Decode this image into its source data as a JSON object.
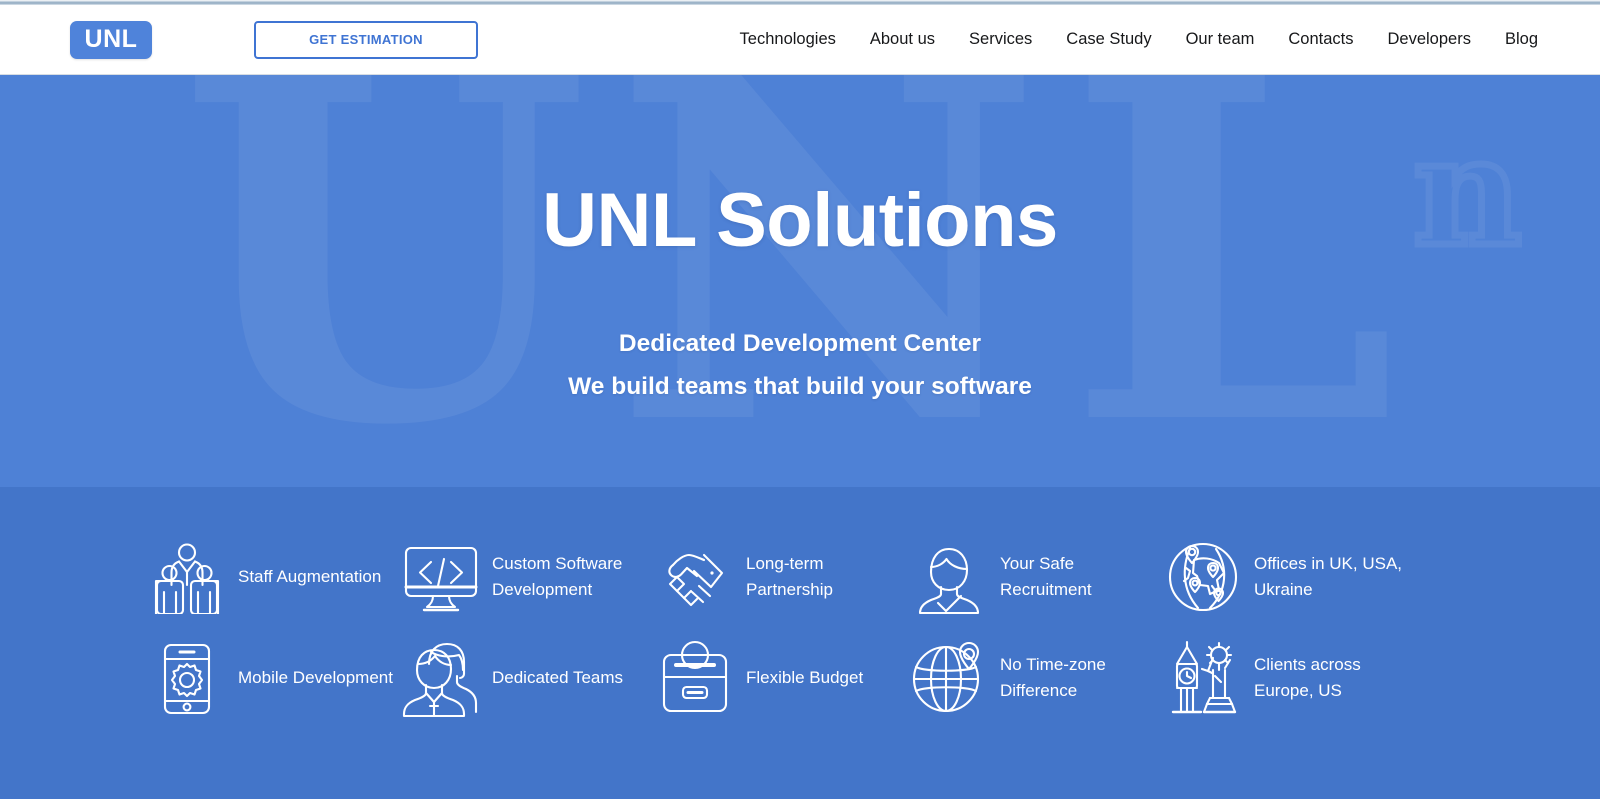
{
  "header": {
    "logo_text": "UNL",
    "cta_label": "GET ESTIMATION",
    "nav": [
      {
        "label": "Technologies"
      },
      {
        "label": "About us"
      },
      {
        "label": "Services"
      },
      {
        "label": "Case Study"
      },
      {
        "label": "Our team"
      },
      {
        "label": "Contacts"
      },
      {
        "label": "Developers"
      },
      {
        "label": "Blog"
      }
    ]
  },
  "hero": {
    "title": "UNL Solutions",
    "subtitle_line1": "Dedicated Development Center",
    "subtitle_line2": "We build teams that build your software",
    "watermark_text": "UNL",
    "watermark_small_text": "n"
  },
  "features": {
    "row1": [
      {
        "icon": "team-people-icon",
        "label": "Staff Augmentation"
      },
      {
        "icon": "code-monitor-icon",
        "label": "Custom Software Development"
      },
      {
        "icon": "handshake-icon",
        "label": "Long-term Partnership"
      },
      {
        "icon": "person-check-icon",
        "label": "Your Safe Recruitment"
      },
      {
        "icon": "globe-pins-icon",
        "label": "Offices in UK, USA, Ukraine"
      }
    ],
    "row2": [
      {
        "icon": "mobile-gear-icon",
        "label": "Mobile Development"
      },
      {
        "icon": "team-avatars-icon",
        "label": "Dedicated Teams"
      },
      {
        "icon": "briefcase-icon",
        "label": "Flexible Budget"
      },
      {
        "icon": "globe-pin-icon",
        "label": "No Time-zone Difference"
      },
      {
        "icon": "landmarks-icon",
        "label": "Clients across Europe, US"
      }
    ]
  },
  "colors": {
    "brand_blue": "#4f83da",
    "hero_bg": "#4e81d6",
    "features_bg": "#4375c9",
    "cta_border": "#3f74d3",
    "header_bg": "#ffffff",
    "text_dark": "#17181a",
    "text_light": "#ffffff"
  }
}
